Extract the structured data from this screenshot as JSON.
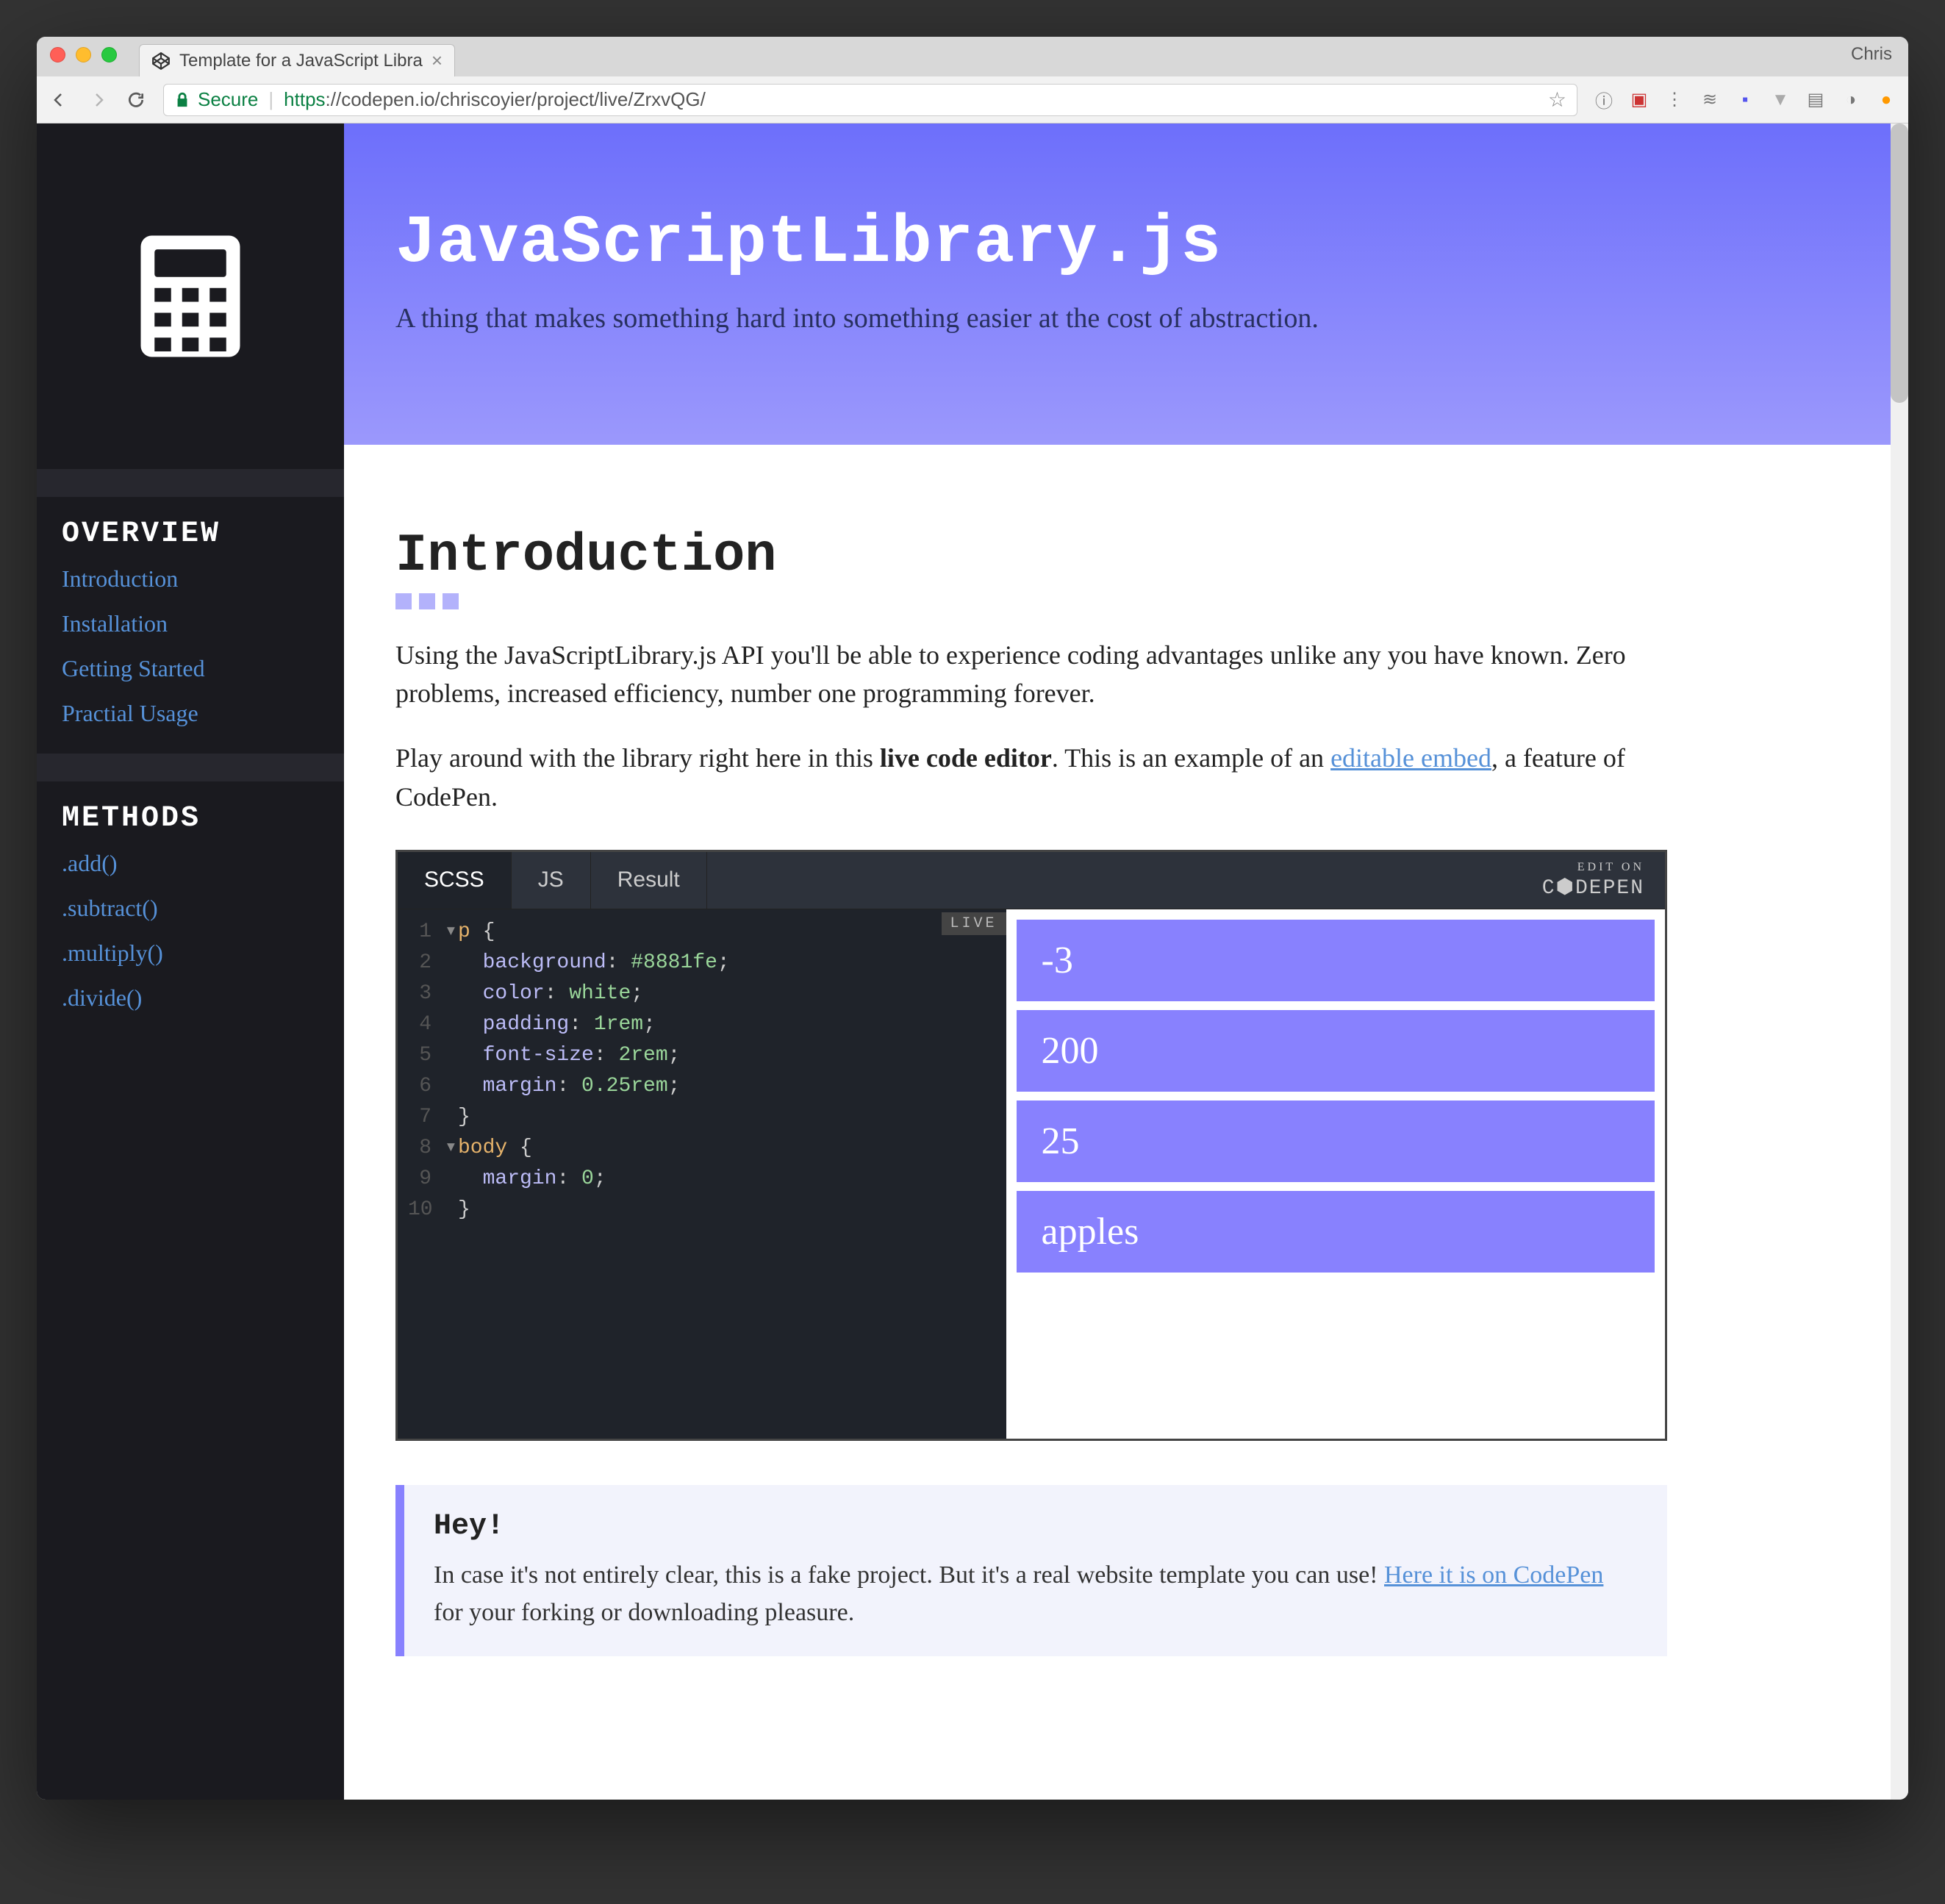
{
  "browser": {
    "tab_title": "Template for a JavaScript Libra",
    "user": "Chris",
    "secure_label": "Secure",
    "url_proto": "https",
    "url_rest": "://codepen.io/chriscoyier/project/live/ZrxvQG/"
  },
  "sidebar": {
    "section_overview": "OVERVIEW",
    "overview_items": [
      "Introduction",
      "Installation",
      "Getting Started",
      "Practial Usage"
    ],
    "section_methods": "METHODS",
    "method_items": [
      ".add()",
      ".subtract()",
      ".multiply()",
      ".divide()"
    ]
  },
  "hero": {
    "title": "JavaScriptLibrary.js",
    "subtitle": "A thing that makes something hard into something easier at the cost of abstraction."
  },
  "intro": {
    "heading": "Introduction",
    "p1": "Using the JavaScriptLibrary.js API you'll be able to experience coding advantages unlike any you have known. Zero problems, increased efficiency, number one programming forever.",
    "p2a": "Play around with the library right here in this ",
    "p2b": "live code editor",
    "p2c": ". This is an example of an ",
    "p2link": "editable embed",
    "p2d": ", a feature of CodePen."
  },
  "embed": {
    "tabs": [
      "SCSS",
      "JS",
      "Result"
    ],
    "active_tab": "SCSS",
    "edit_small": "EDIT ON",
    "edit_big": "C⬢DEPEN",
    "live_badge": "LIVE",
    "code_lines": [
      {
        "n": "1",
        "fold": "▾",
        "sel": "p ",
        "pun": "{"
      },
      {
        "n": "2",
        "indent": true,
        "key": "background",
        "pun1": ": ",
        "val": "#8881fe",
        "pun2": ";"
      },
      {
        "n": "3",
        "indent": true,
        "key": "color",
        "pun1": ": ",
        "val": "white",
        "pun2": ";"
      },
      {
        "n": "4",
        "indent": true,
        "key": "padding",
        "pun1": ": ",
        "val": "1rem",
        "pun2": ";"
      },
      {
        "n": "5",
        "indent": true,
        "key": "font-size",
        "pun1": ": ",
        "val": "2rem",
        "pun2": ";"
      },
      {
        "n": "6",
        "indent": true,
        "key": "margin",
        "pun1": ": ",
        "val": "0.25rem",
        "pun2": ";"
      },
      {
        "n": "7",
        "pun": "}"
      },
      {
        "n": "8",
        "fold": "▾",
        "sel": "body ",
        "pun": "{"
      },
      {
        "n": "9",
        "indent": true,
        "key": "margin",
        "pun1": ": ",
        "val": "0",
        "pun2": ";"
      },
      {
        "n": "10",
        "pun": "}"
      }
    ],
    "preview_values": [
      "-3",
      "200",
      "25",
      "apples"
    ]
  },
  "callout": {
    "heading": "Hey!",
    "text1": "In case it's not entirely clear, this is a fake project. But it's a real website template you can use! ",
    "link": "Here it is on CodePen",
    "text2": " for your forking or downloading pleasure."
  }
}
